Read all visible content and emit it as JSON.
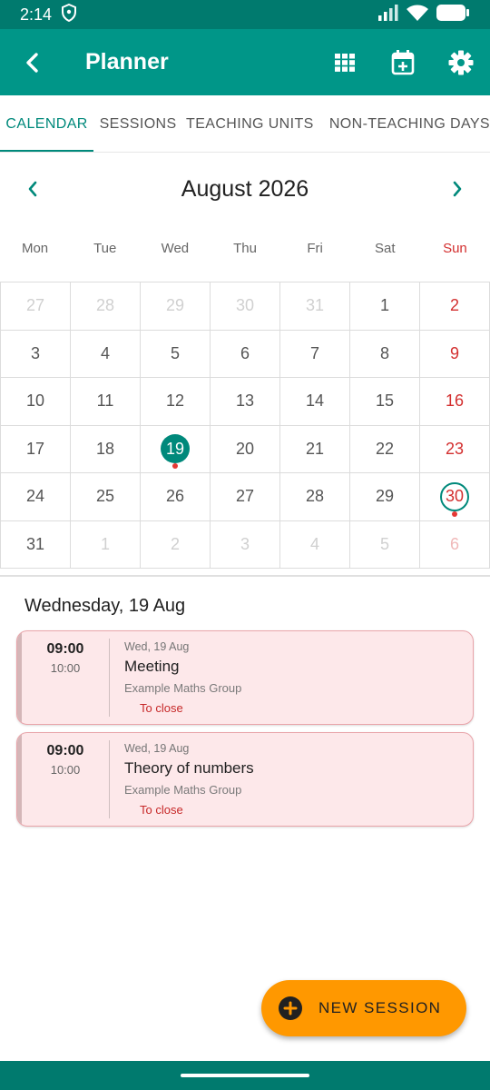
{
  "status_bar": {
    "time": "2:14"
  },
  "app_bar": {
    "title": "Planner"
  },
  "tabs": [
    {
      "label": "CALENDAR",
      "active": true
    },
    {
      "label": "SESSIONS",
      "active": false
    },
    {
      "label": "TEACHING UNITS",
      "active": false
    },
    {
      "label": "NON-TEACHING DAYS",
      "active": false
    }
  ],
  "calendar": {
    "month_title": "August 2026",
    "weekdays": [
      "Mon",
      "Tue",
      "Wed",
      "Thu",
      "Fri",
      "Sat",
      "Sun"
    ],
    "weeks": [
      [
        {
          "day": "27",
          "in_month": false
        },
        {
          "day": "28",
          "in_month": false
        },
        {
          "day": "29",
          "in_month": false
        },
        {
          "day": "30",
          "in_month": false
        },
        {
          "day": "31",
          "in_month": false
        },
        {
          "day": "1",
          "in_month": true
        },
        {
          "day": "2",
          "in_month": true
        }
      ],
      [
        {
          "day": "3",
          "in_month": true
        },
        {
          "day": "4",
          "in_month": true
        },
        {
          "day": "5",
          "in_month": true
        },
        {
          "day": "6",
          "in_month": true
        },
        {
          "day": "7",
          "in_month": true
        },
        {
          "day": "8",
          "in_month": true
        },
        {
          "day": "9",
          "in_month": true
        }
      ],
      [
        {
          "day": "10",
          "in_month": true
        },
        {
          "day": "11",
          "in_month": true
        },
        {
          "day": "12",
          "in_month": true
        },
        {
          "day": "13",
          "in_month": true
        },
        {
          "day": "14",
          "in_month": true
        },
        {
          "day": "15",
          "in_month": true
        },
        {
          "day": "16",
          "in_month": true
        }
      ],
      [
        {
          "day": "17",
          "in_month": true
        },
        {
          "day": "18",
          "in_month": true
        },
        {
          "day": "19",
          "in_month": true,
          "selected": true,
          "has_event": true
        },
        {
          "day": "20",
          "in_month": true
        },
        {
          "day": "21",
          "in_month": true
        },
        {
          "day": "22",
          "in_month": true
        },
        {
          "day": "23",
          "in_month": true
        }
      ],
      [
        {
          "day": "24",
          "in_month": true
        },
        {
          "day": "25",
          "in_month": true
        },
        {
          "day": "26",
          "in_month": true
        },
        {
          "day": "27",
          "in_month": true
        },
        {
          "day": "28",
          "in_month": true
        },
        {
          "day": "29",
          "in_month": true
        },
        {
          "day": "30",
          "in_month": true,
          "today": true,
          "has_event": true
        }
      ],
      [
        {
          "day": "31",
          "in_month": true
        },
        {
          "day": "1",
          "in_month": false
        },
        {
          "day": "2",
          "in_month": false
        },
        {
          "day": "3",
          "in_month": false
        },
        {
          "day": "4",
          "in_month": false
        },
        {
          "day": "5",
          "in_month": false
        },
        {
          "day": "6",
          "in_month": false
        }
      ]
    ]
  },
  "day_view": {
    "heading": "Wednesday, 19 Aug",
    "sessions": [
      {
        "start": "09:00",
        "end": "10:00",
        "date": "Wed, 19 Aug",
        "title": "Meeting",
        "group": "Example Maths Group",
        "status": "To close"
      },
      {
        "start": "09:00",
        "end": "10:00",
        "date": "Wed, 19 Aug",
        "title": "Theory of numbers",
        "group": "Example Maths Group",
        "status": "To close"
      }
    ]
  },
  "fab": {
    "label": "NEW SESSION"
  },
  "colors": {
    "primary": "#009688",
    "status_bar": "#007a6e",
    "accent": "#ff9800",
    "sunday": "#d32f2f",
    "card_bg": "#fde8ea"
  }
}
